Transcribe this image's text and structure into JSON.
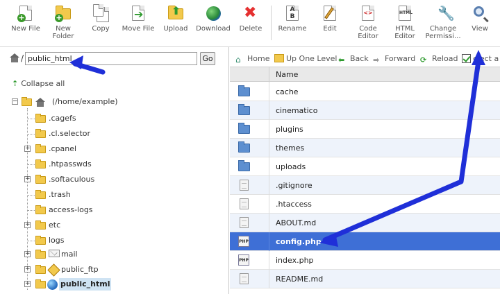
{
  "toolbar": {
    "new_file": "New File",
    "new_folder_1": "New",
    "new_folder_2": "Folder",
    "copy": "Copy",
    "move_file": "Move File",
    "upload": "Upload",
    "download": "Download",
    "delete": "Delete",
    "rename": "Rename",
    "edit": "Edit",
    "code_editor_1": "Code",
    "code_editor_2": "Editor",
    "html_editor_1": "HTML",
    "html_editor_2": "Editor",
    "change_permissions_1": "Change",
    "change_permissions_2": "Permissi...",
    "view": "View",
    "html_icon_text": "HTML"
  },
  "path": {
    "separator": "/",
    "value": "public_html",
    "go_label": "Go"
  },
  "tree": {
    "collapse_all": "Collapse all",
    "root_label": "(/home/example)",
    "items": [
      {
        "label": ".cagefs"
      },
      {
        "label": ".cl.selector"
      },
      {
        "label": ".cpanel"
      },
      {
        "label": ".htpasswds"
      },
      {
        "label": ".softaculous"
      },
      {
        "label": ".trash"
      },
      {
        "label": "access-logs"
      },
      {
        "label": "etc"
      },
      {
        "label": "logs"
      },
      {
        "label": "mail"
      },
      {
        "label": "public_ftp"
      },
      {
        "label": "public_html"
      }
    ]
  },
  "nav": {
    "home": "Home",
    "up_one_level": "Up One Level",
    "back": "Back",
    "forward": "Forward",
    "reload": "Reload",
    "select_all": "elect a"
  },
  "table": {
    "name_header": "Name",
    "php_icon_text": "PHP",
    "rows": [
      {
        "name": "cache"
      },
      {
        "name": "cinematico"
      },
      {
        "name": "plugins"
      },
      {
        "name": "themes"
      },
      {
        "name": "uploads"
      },
      {
        "name": ".gitignore"
      },
      {
        "name": ".htaccess"
      },
      {
        "name": "ABOUT.md"
      },
      {
        "name": "config.php"
      },
      {
        "name": "index.php"
      },
      {
        "name": "README.md"
      }
    ]
  },
  "colors": {
    "selected_row": "#3e6fd6",
    "annotation_arrow": "#1f2fd8",
    "folder_blue": "#5d8fd0",
    "folder_yellow": "#f2c94c"
  }
}
